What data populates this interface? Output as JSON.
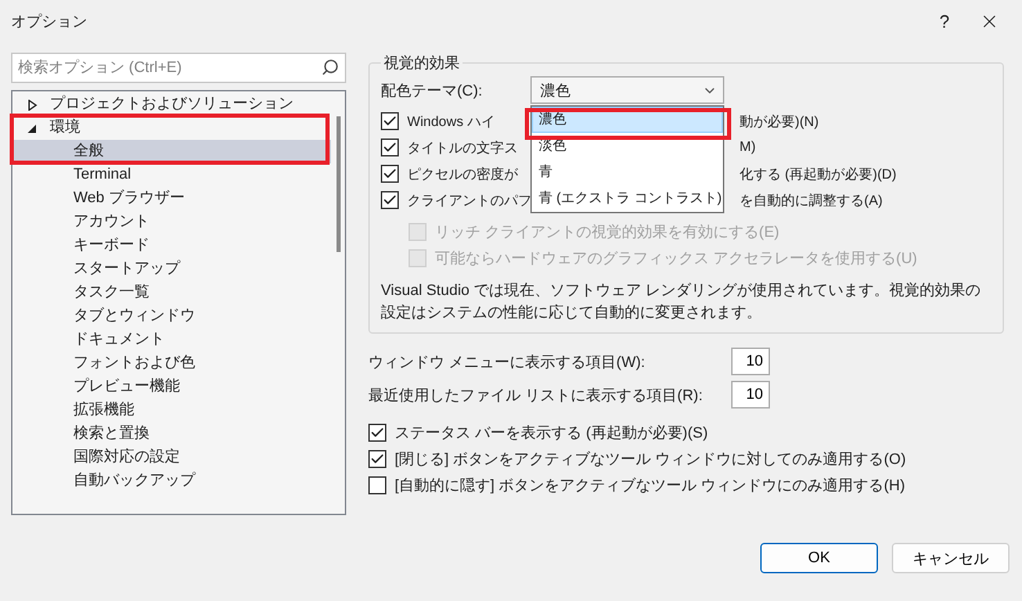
{
  "window": {
    "title": "オプション",
    "help": "?"
  },
  "search": {
    "placeholder": "検索オプション (Ctrl+E)"
  },
  "tree": [
    {
      "label": "プロジェクトおよびソリューション",
      "expanded": false,
      "selected": false
    },
    {
      "label": "環境",
      "expanded": true,
      "selected": false,
      "children": [
        {
          "label": "全般",
          "selected": true
        },
        {
          "label": "Terminal",
          "selected": false
        },
        {
          "label": "Web ブラウザー",
          "selected": false
        },
        {
          "label": "アカウント",
          "selected": false
        },
        {
          "label": "キーボード",
          "selected": false
        },
        {
          "label": "スタートアップ",
          "selected": false
        },
        {
          "label": "タスク一覧",
          "selected": false
        },
        {
          "label": "タブとウィンドウ",
          "selected": false
        },
        {
          "label": "ドキュメント",
          "selected": false
        },
        {
          "label": "フォントおよび色",
          "selected": false
        },
        {
          "label": "プレビュー機能",
          "selected": false
        },
        {
          "label": "拡張機能",
          "selected": false
        },
        {
          "label": "検索と置換",
          "selected": false
        },
        {
          "label": "国際対応の設定",
          "selected": false
        },
        {
          "label": "自動バックアップ",
          "selected": false
        }
      ]
    }
  ],
  "visual_effects": {
    "title": "視覚的効果",
    "theme_label": "配色テーマ(C):",
    "theme_value": "濃色",
    "theme_options": [
      {
        "label": "濃色",
        "selected": true
      },
      {
        "label": "淡色",
        "selected": false
      },
      {
        "label": "青",
        "selected": false
      },
      {
        "label": "青 (エクストラ コントラスト)",
        "selected": false
      }
    ],
    "options": [
      {
        "checked": true,
        "label_start": "Windows ハイ",
        "label_end": "動が必要)(N)"
      },
      {
        "checked": true,
        "label_start": "タイトルの文字ス",
        "label_end": "M)"
      },
      {
        "checked": true,
        "label_start": "ピクセルの密度が",
        "label_end": "化する (再起動が必要)(D)"
      },
      {
        "checked": true,
        "label_start": "クライアントのパフ",
        "label_end": "を自動的に調整する(A)"
      }
    ],
    "sub_options": [
      {
        "label": "リッチ クライアントの視覚的効果を有効にする(E)",
        "checked": false,
        "disabled": true
      },
      {
        "label": "可能ならハードウェアのグラフィックス アクセラレータを使用する(U)",
        "checked": false,
        "disabled": true
      }
    ],
    "note": "Visual Studio では現在、ソフトウェア レンダリングが使用されています。視覚的効果の設定はシステムの性能に応じて自動的に変更されます。"
  },
  "counts": [
    {
      "label": "ウィンドウ メニューに表示する項目(W):",
      "value": "10"
    },
    {
      "label": "最近使用したファイル リストに表示する項目(R):",
      "value": "10"
    }
  ],
  "checks": [
    {
      "label": "ステータス バーを表示する (再起動が必要)(S)",
      "checked": true
    },
    {
      "label": "[閉じる] ボタンをアクティブなツール ウィンドウに対してのみ適用する(O)",
      "checked": true
    },
    {
      "label": "[自動的に隠す] ボタンをアクティブなツール ウィンドウにのみ適用する(H)",
      "checked": false
    }
  ],
  "buttons": [
    {
      "label": "OK",
      "default": true
    },
    {
      "label": "キャンセル",
      "default": false
    }
  ]
}
